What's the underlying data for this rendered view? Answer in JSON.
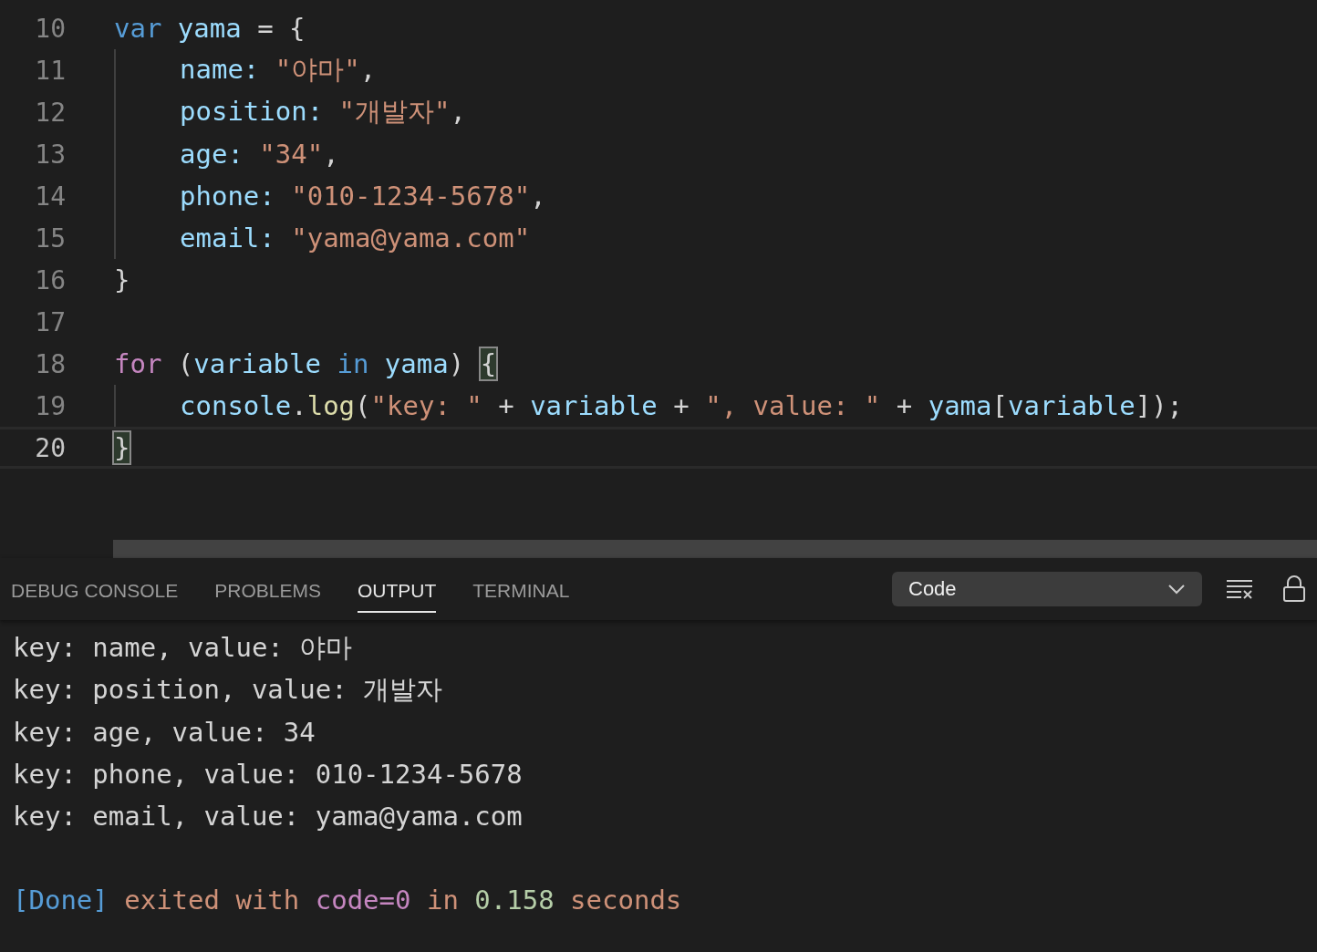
{
  "editor": {
    "lines": [
      {
        "number": "10",
        "current": false,
        "indented": false,
        "tokens": [
          {
            "text": "var",
            "kind": "keyword"
          },
          {
            "text": " yama",
            "kind": "variable"
          },
          {
            "text": " = {"
          }
        ]
      },
      {
        "number": "11",
        "current": false,
        "indented": true,
        "tokens": [
          {
            "text": "name: ",
            "kind": "variable"
          },
          {
            "text": "\"야마\"",
            "kind": "string"
          },
          {
            "text": ","
          }
        ]
      },
      {
        "number": "12",
        "current": false,
        "indented": true,
        "tokens": [
          {
            "text": "position: ",
            "kind": "variable"
          },
          {
            "text": "\"개발자\"",
            "kind": "string"
          },
          {
            "text": ","
          }
        ]
      },
      {
        "number": "13",
        "current": false,
        "indented": true,
        "tokens": [
          {
            "text": "age: ",
            "kind": "variable"
          },
          {
            "text": "\"34\"",
            "kind": "string"
          },
          {
            "text": ","
          }
        ]
      },
      {
        "number": "14",
        "current": false,
        "indented": true,
        "tokens": [
          {
            "text": "phone: ",
            "kind": "variable"
          },
          {
            "text": "\"010-1234-5678\"",
            "kind": "string"
          },
          {
            "text": ","
          }
        ]
      },
      {
        "number": "15",
        "current": false,
        "indented": true,
        "tokens": [
          {
            "text": "email: ",
            "kind": "variable"
          },
          {
            "text": "\"yama@yama.com\"",
            "kind": "string"
          }
        ]
      },
      {
        "number": "16",
        "current": false,
        "indented": false,
        "tokens": [
          {
            "text": "}"
          }
        ]
      },
      {
        "number": "17",
        "current": false,
        "indented": false
      },
      {
        "number": "18",
        "current": false,
        "indented": false,
        "tokens": [
          {
            "text": "for",
            "kind": "control"
          },
          {
            "text": " ("
          },
          {
            "text": "variable",
            "kind": "variable"
          },
          {
            "text": " in",
            "kind": "keyword"
          },
          {
            "text": " yama",
            "kind": "variable"
          },
          {
            "text": ") "
          },
          {
            "text": "{",
            "matched": true
          }
        ]
      },
      {
        "number": "19",
        "current": false,
        "indented": true,
        "tokens": [
          {
            "text": "console",
            "kind": "variable"
          },
          {
            "text": "."
          },
          {
            "text": "log",
            "kind": "function"
          },
          {
            "text": "("
          },
          {
            "text": "\"key: \"",
            "kind": "string"
          },
          {
            "text": " + "
          },
          {
            "text": "variable",
            "kind": "variable"
          },
          {
            "text": " + "
          },
          {
            "text": "\", value: \"",
            "kind": "string"
          },
          {
            "text": " + "
          },
          {
            "text": "yama",
            "kind": "variable"
          },
          {
            "text": "["
          },
          {
            "text": "variable",
            "kind": "variable"
          },
          {
            "text": "]);"
          }
        ]
      },
      {
        "number": "20",
        "current": true,
        "indented": false,
        "tokens": [
          {
            "text": "}",
            "matched": true
          }
        ]
      }
    ]
  },
  "panel": {
    "tabs": [
      {
        "label": "DEBUG CONSOLE",
        "selected": false
      },
      {
        "label": "PROBLEMS",
        "selected": false
      },
      {
        "label": "OUTPUT",
        "selected": true
      },
      {
        "label": "TERMINAL",
        "selected": false
      }
    ],
    "channel": {
      "value": "Code"
    },
    "output": [
      {
        "tokens": [
          {
            "text": "key: name, value: 야마"
          }
        ]
      },
      {
        "tokens": [
          {
            "text": "key: position, value: 개발자"
          }
        ]
      },
      {
        "tokens": [
          {
            "text": "key: age, value: 34"
          }
        ]
      },
      {
        "tokens": [
          {
            "text": "key: phone, value: 010-1234-5678"
          }
        ]
      },
      {
        "tokens": [
          {
            "text": "key: email, value: yama@yama.com"
          }
        ]
      },
      {
        "tokens": [
          {
            "text": "[Done]",
            "kind": "keyword"
          },
          {
            "text": " exited with",
            "kind": "string"
          },
          {
            "text": " code=0",
            "kind": "control"
          },
          {
            "text": " in",
            "kind": "string"
          },
          {
            "text": " 0.158",
            "kind": "number"
          },
          {
            "text": " seconds",
            "kind": "string"
          }
        ]
      }
    ]
  }
}
